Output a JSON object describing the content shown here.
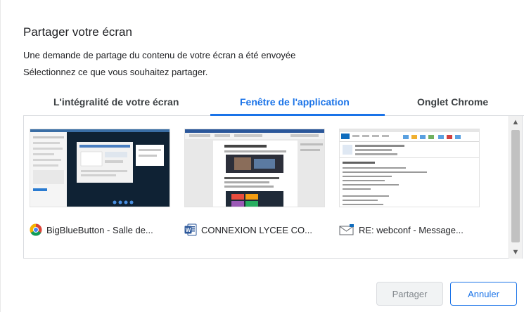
{
  "dialog": {
    "title": "Partager votre écran",
    "message1": "Une demande de partage du contenu de votre écran a été envoyée",
    "message2": "Sélectionnez ce que vous souhaitez partager."
  },
  "tabs": [
    {
      "label": "L'intégralité de votre écran",
      "active": false
    },
    {
      "label": "Fenêtre de l'application",
      "active": true
    },
    {
      "label": "Onglet Chrome",
      "active": false
    }
  ],
  "windows": [
    {
      "label": "BigBlueButton - Salle de...",
      "icon": "chrome-icon"
    },
    {
      "label": "CONNEXION LYCEE CO...",
      "icon": "word-icon"
    },
    {
      "label": "RE: webconf - Message...",
      "icon": "mail-icon"
    }
  ],
  "buttons": {
    "share": "Partager",
    "cancel": "Annuler"
  },
  "colors": {
    "accent": "#1a73e8",
    "text": "#202124",
    "disabled_text": "#80868b"
  }
}
